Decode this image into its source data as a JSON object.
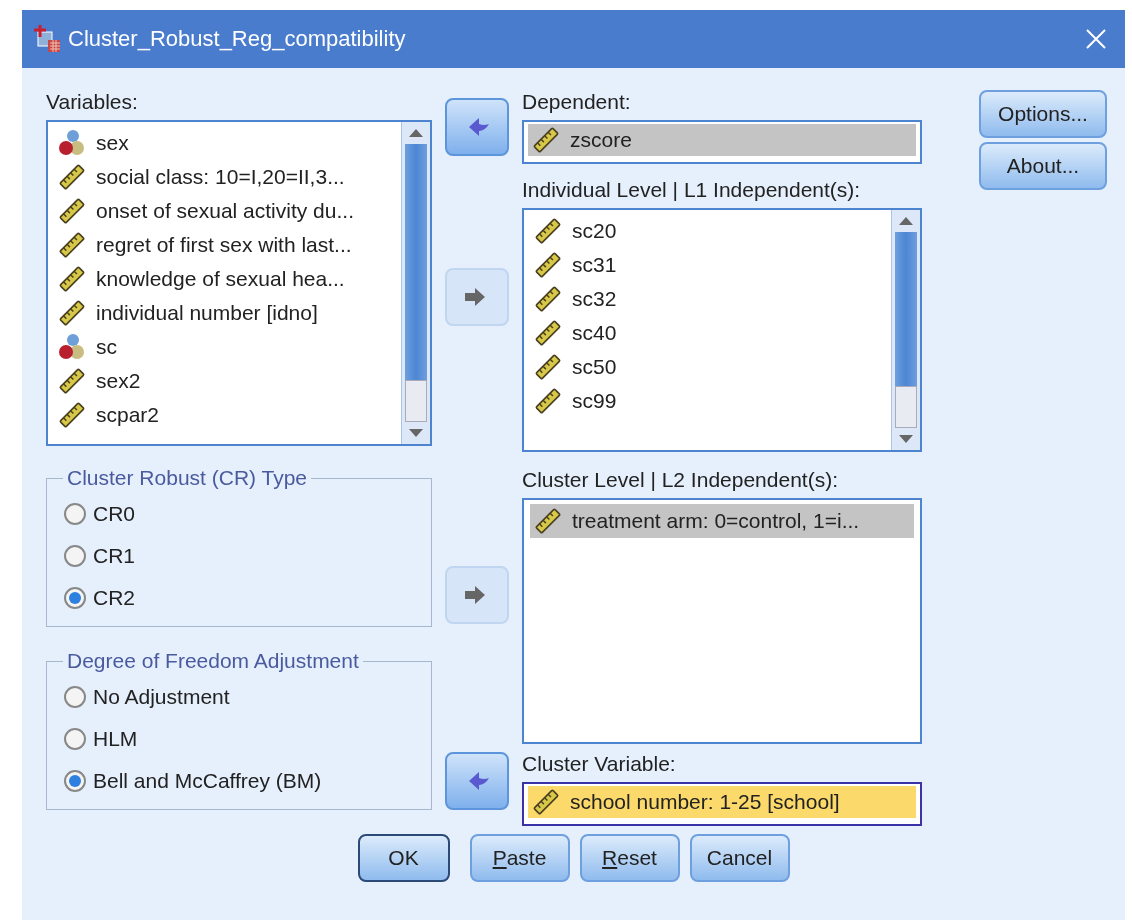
{
  "window": {
    "title": "Cluster_Robust_Reg_compatibility"
  },
  "variables": {
    "label": "Variables:",
    "items": [
      {
        "name": "sex",
        "kind": "nominal"
      },
      {
        "name": "social class: 10=I,20=II,3...",
        "kind": "scale"
      },
      {
        "name": "onset of sexual activity du...",
        "kind": "scale"
      },
      {
        "name": "regret of first sex with last...",
        "kind": "scale"
      },
      {
        "name": "knowledge of sexual hea...",
        "kind": "scale"
      },
      {
        "name": "individual number [idno]",
        "kind": "scale"
      },
      {
        "name": "sc",
        "kind": "nominal"
      },
      {
        "name": "sex2",
        "kind": "scale"
      },
      {
        "name": "scpar2",
        "kind": "scale"
      }
    ]
  },
  "cr_type": {
    "title": "Cluster Robust (CR) Type",
    "options": [
      {
        "label": "CR0",
        "selected": false
      },
      {
        "label": "CR1",
        "selected": false
      },
      {
        "label": "CR2",
        "selected": true
      }
    ]
  },
  "df_adjustment": {
    "title": "Degree of Freedom Adjustment",
    "options": [
      {
        "label": "No Adjustment",
        "selected": false
      },
      {
        "label": "HLM",
        "selected": false
      },
      {
        "label": "Bell and McCaffrey (BM)",
        "selected": true
      }
    ]
  },
  "arrows": [
    {
      "kind": "move_left",
      "enabled": true
    },
    {
      "kind": "move_right",
      "enabled": false
    },
    {
      "kind": "move_right",
      "enabled": false
    },
    {
      "kind": "move_left",
      "enabled": true
    }
  ],
  "dependent": {
    "label": "Dependent:",
    "focused": false,
    "items": [
      {
        "name": "zscore",
        "kind": "scale",
        "selected": true
      }
    ]
  },
  "individual_level": {
    "label": "Individual Level | L1 Independent(s):",
    "items": [
      {
        "name": "sc20",
        "kind": "scale",
        "selected": false
      },
      {
        "name": "sc31",
        "kind": "scale",
        "selected": false
      },
      {
        "name": "sc32",
        "kind": "scale",
        "selected": false
      },
      {
        "name": "sc40",
        "kind": "scale",
        "selected": false
      },
      {
        "name": "sc50",
        "kind": "scale",
        "selected": false
      },
      {
        "name": "sc99",
        "kind": "scale",
        "selected": false
      }
    ]
  },
  "cluster_level": {
    "label": "Cluster Level | L2 Independent(s):",
    "items": [
      {
        "name": "treatment arm: 0=control, 1=i...",
        "kind": "scale",
        "selected": true
      }
    ]
  },
  "cluster_variable": {
    "label": "Cluster Variable:",
    "focused": true,
    "items": [
      {
        "name": "school number: 1-25 [school]",
        "kind": "scale",
        "selected": true
      }
    ]
  },
  "side_buttons": [
    {
      "label": "Options..."
    },
    {
      "label": "About..."
    }
  ],
  "buttons": [
    {
      "label": "OK",
      "default": true,
      "mnemonic": false
    },
    {
      "label": "Paste",
      "default": false,
      "mnemonic": true
    },
    {
      "label": "Reset",
      "default": false,
      "mnemonic": true
    },
    {
      "label": "Cancel",
      "default": false,
      "mnemonic": false
    }
  ]
}
